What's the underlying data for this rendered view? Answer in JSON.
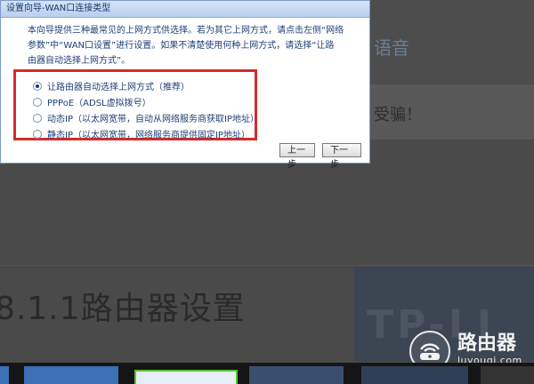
{
  "dialog": {
    "title": "设置向导-WAN口连接类型",
    "desc_line1": "本向导提供三种最常见的上网方式供选择。若为其它上网方式，请点击左侧“网络",
    "desc_line2": "参数”中“WAN口设置”进行设置。如果不清楚使用何种上网方式，请选择“让路",
    "desc_line3": "由器自动选择上网方式”。",
    "options": [
      {
        "label": "让路由器自动选择上网方式（推荐）",
        "selected": true
      },
      {
        "label": "PPPoE（ADSL虚拟拨号）",
        "selected": false
      },
      {
        "label": "动态IP（以太网宽带，自动从网络服务商获取IP地址）",
        "selected": false
      },
      {
        "label": "静态IP（以太网宽带，网络服务商提供固定IP地址）",
        "selected": false
      }
    ],
    "prev_button": "上一步",
    "next_button": "下一步"
  },
  "background": {
    "partial_text_a": "语音",
    "partial_text_b": "受骗！",
    "heading": "8.1.1路由器设置",
    "banner_text": "TP-LI"
  },
  "watermark": {
    "title": "路由器",
    "subtitle": "luyouqi.com"
  },
  "colors": {
    "highlight_box": "#d62a2a",
    "dialog_title_bar": "#c7d9f2",
    "text_blue": "#1f3f77"
  }
}
